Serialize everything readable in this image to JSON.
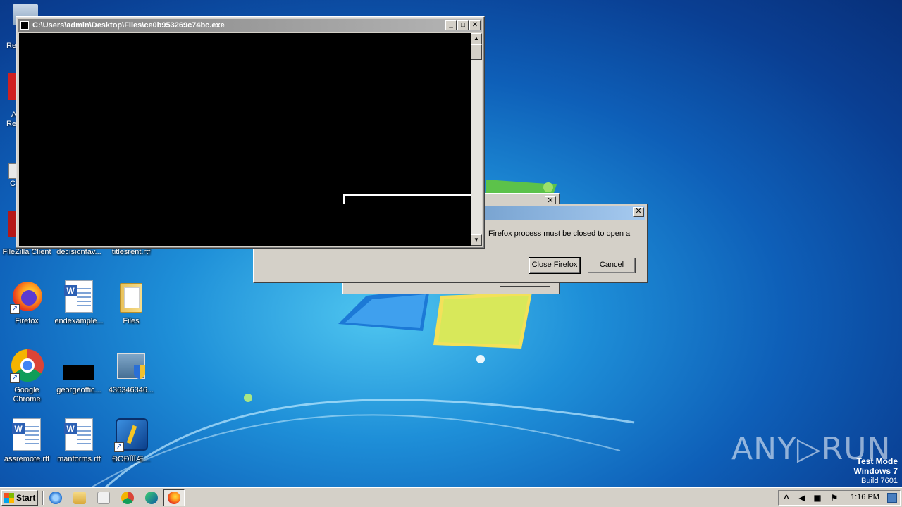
{
  "desktop": {
    "icons": [
      {
        "label": "FileZilla Client"
      },
      {
        "label": "decisionfav..."
      },
      {
        "label": "titlesrent.rtf"
      },
      {
        "label": "Firefox"
      },
      {
        "label": "endexample..."
      },
      {
        "label": "Files"
      },
      {
        "label": "Google Chrome"
      },
      {
        "label": "georgeoffic..."
      },
      {
        "label": "436346346..."
      },
      {
        "label": "assremote.rtf"
      },
      {
        "label": "manforms.rtf"
      },
      {
        "label": "ÐÒÐÎÏÏÆ..."
      }
    ],
    "partial_labels": [
      "Re",
      "A",
      "Re",
      "C"
    ]
  },
  "console_window": {
    "title": "C:\\Users\\admin\\Desktop\\Files\\ce0b953269c74bc.exe",
    "minimize_glyph": "_",
    "maximize_glyph": "□",
    "close_glyph": "✕",
    "scroll_up_glyph": "▲",
    "scroll_down_glyph": "▼"
  },
  "firefox_dialog": {
    "message": "Firefox process must be closed to open a",
    "close_firefox_label": "Close Firefox",
    "cancel_label": "Cancel",
    "close_glyph": "✕"
  },
  "watermark": {
    "brand": "ANY▷RUN",
    "line1": "Test Mode",
    "line2": "Windows 7",
    "line3": "Build 7601"
  },
  "taskbar": {
    "start_label": "Start",
    "clock": "1:16 PM",
    "tray_show_hidden": "^"
  },
  "colors": {
    "desktop_blue": "#1e8fd8",
    "window_face": "#d4d0c8",
    "dialog_title_blue": "#3a6ea5"
  }
}
